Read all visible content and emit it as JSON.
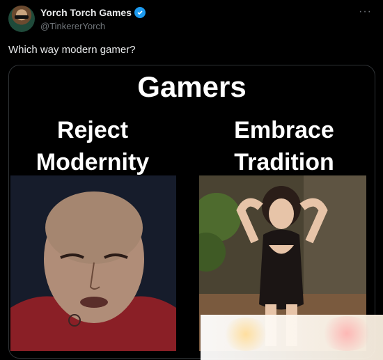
{
  "post": {
    "display_name": "Yorch Torch Games",
    "handle": "@TinkererYorch",
    "text": "Which way modern gamer?",
    "more_icon": "more-horizontal-icon",
    "verified_icon": "verified-badge-icon"
  },
  "meme": {
    "title": "Gamers",
    "left_caption": "Reject Modernity",
    "right_caption": "Embrace Tradition"
  },
  "colors": {
    "background": "#000000",
    "text_primary": "#e7e9ea",
    "text_secondary": "#71767b",
    "verified": "#1d9bf0",
    "card_border": "#2f3336"
  }
}
